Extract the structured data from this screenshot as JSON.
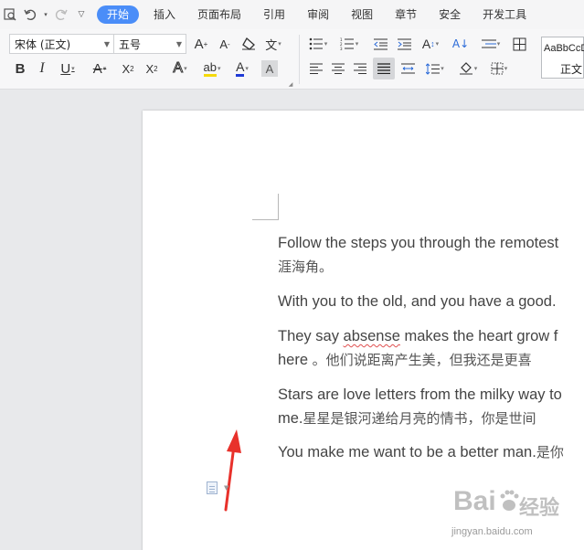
{
  "menubar": {
    "tabs": [
      "开始",
      "插入",
      "页面布局",
      "引用",
      "审阅",
      "视图",
      "章节",
      "安全",
      "开发工具"
    ]
  },
  "ribbon": {
    "font_name": "宋体 (正文)",
    "font_size": "五号",
    "style_sample": "AaBbCcDd",
    "style_name": "正文"
  },
  "document": {
    "p1_en": "Follow the steps you through the remotest",
    "p1_cn": "涯海角。",
    "p2": "With you to the old, and you have a good.",
    "p3_a": "They say ",
    "p3_misspelled": "absense",
    "p3_b": " makes the heart grow f",
    "p3_line2_en": "here ",
    "p3_line2_cn": "。他们说距离产生美，但我还是更喜",
    "p4_en": "Stars are love letters from the milky way to",
    "p4_line2_en": "me.",
    "p4_line2_cn": "星星是银河递给月亮的情书，你是世间",
    "p5_en": "You make me want to be a better man.",
    "p5_cn": "是你"
  },
  "watermark": {
    "brand_en": "Bai",
    "brand_cn": "经验",
    "url": "jingyan.baidu.com"
  },
  "colors": {
    "accent": "#4a8df8",
    "annotation_arrow": "#e8312b",
    "highlight_yellow": "#f5d90a",
    "font_color_blue": "#1f3bd6"
  }
}
